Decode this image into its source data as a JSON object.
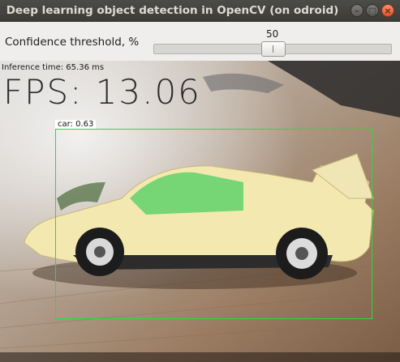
{
  "window": {
    "title": "Deep learning object detection in OpenCV (on odroid)",
    "buttons": {
      "minimize": "–",
      "maximize": "□",
      "close": "×"
    }
  },
  "controls": {
    "threshold_label": "Confidence threshold, %",
    "threshold_value": "50",
    "threshold_fraction": 0.5
  },
  "overlay": {
    "inference_time": "Inference time: 65.36 ms",
    "fps": "FPS: 13.06"
  },
  "detection": {
    "label": "car: 0.63",
    "box_color": "#2ed93a"
  },
  "colors": {
    "titlebar": "#3c3b37",
    "window_bg": "#efeeec",
    "close_button": "#e0532c"
  }
}
